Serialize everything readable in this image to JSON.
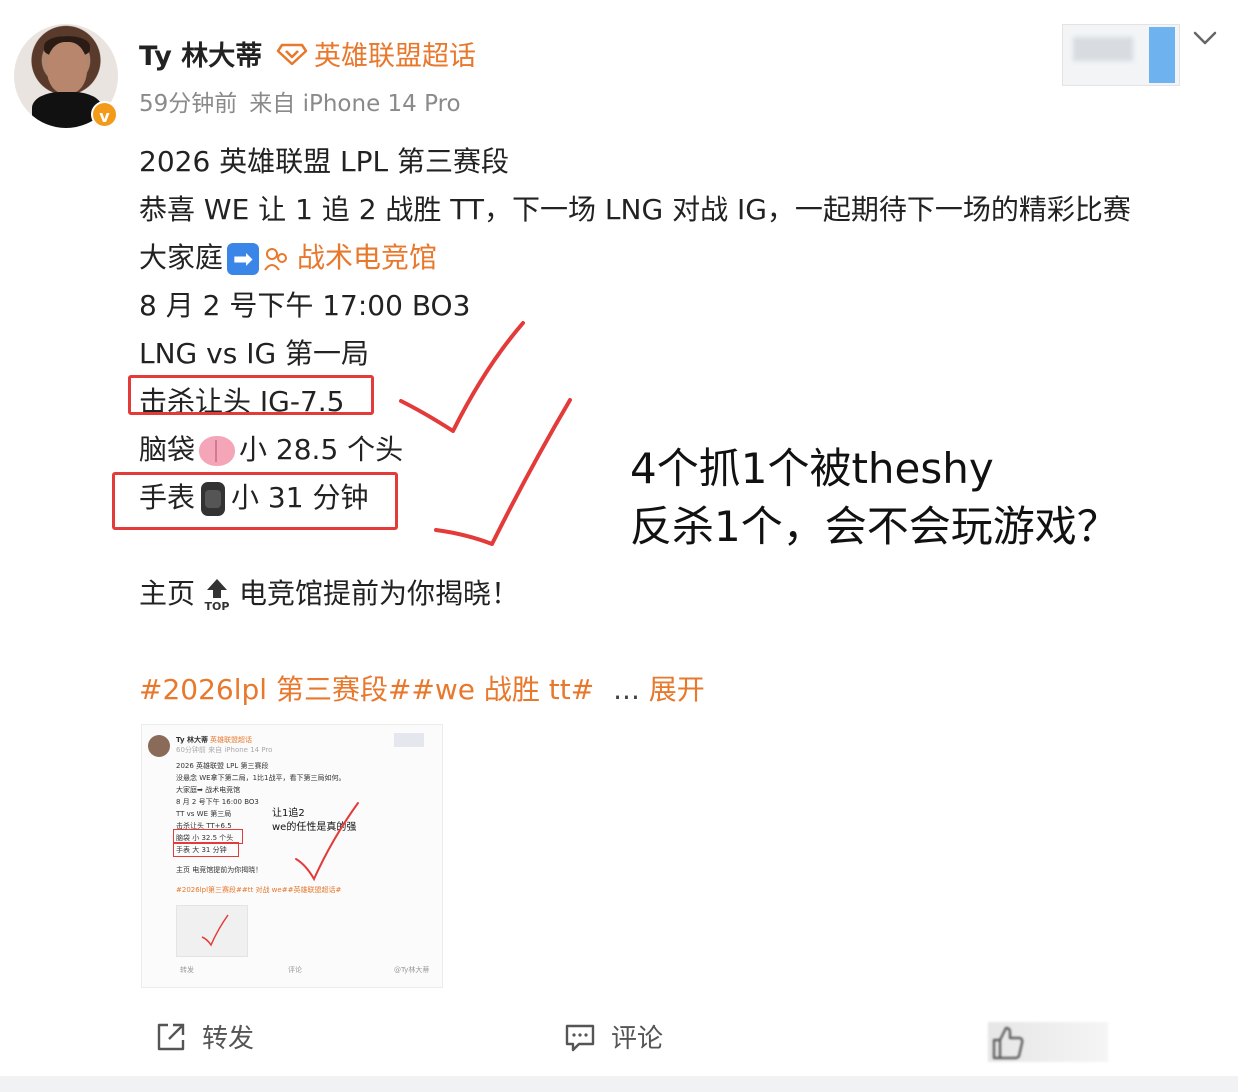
{
  "header": {
    "username": "Ty 林大蒂",
    "topic": "英雄联盟超话",
    "time": "59分钟前",
    "source": "来自 iPhone 14 Pro",
    "verified_badge": "v"
  },
  "post": {
    "line1": "2026 英雄联盟 LPL 第三赛段",
    "line2": "恭喜 WE 让 1 追 2 战胜 TT，下一场 LNG 对战 IG，一起期待下一场的精彩比赛",
    "line3_prefix": "大家庭",
    "line3_arrow": "➡",
    "line3_link": "战术电竞馆",
    "line4": "8 月 2 号下午 17:00 BO3",
    "line5": "LNG vs IG 第一局",
    "line6": "击杀让头 IG-7.5",
    "line7_prefix": "脑袋",
    "line7_suffix": "小 28.5 个头",
    "line8_prefix": "手表",
    "line8_suffix": "小 31 分钟",
    "line9_prefix": "主页",
    "line9_top": "TOP",
    "line9_suffix": "电竞馆提前为你揭晓！",
    "hashtags": "#2026lpl 第三赛段##we 战胜 tt#",
    "ellipsis": "...",
    "expand": "展开"
  },
  "annotation": {
    "line1": "4个抓1个被theshy",
    "line2": "反杀1个，会不会玩游戏？"
  },
  "thumbnail": {
    "username": "Ty 林大蒂",
    "topic": "英雄联盟超话",
    "meta": "60分钟前  来自 iPhone 14 Pro",
    "lines": [
      "2026 英雄联盟 LPL 第三赛段",
      "没悬念 WE拿下第二局，1比1战平，看下第三局如何。",
      "大家庭➡ 战术电竞馆",
      "8 月 2 号下午 16:00 BO3",
      "TT vs WE 第三局",
      "击杀让头 TT+6.5",
      "脑袋 小 32.5 个头",
      "手表 大 31 分钟",
      "主页 电竞馆提前为你揭晓！",
      "#2026lpl第三赛段##tt 对战 we##英雄联盟超话#"
    ],
    "annotation_line1": "让1追2",
    "annotation_line2": "we的任性是真的强",
    "footer_repost": "转发",
    "footer_comment": "评论",
    "watermark": "@Ty林大蒂"
  },
  "footer": {
    "repost": "转发",
    "comment": "评论"
  },
  "colors": {
    "accent": "#e8782c",
    "mark_red": "#e33a3a",
    "meta_gray": "#8a8a8a"
  }
}
